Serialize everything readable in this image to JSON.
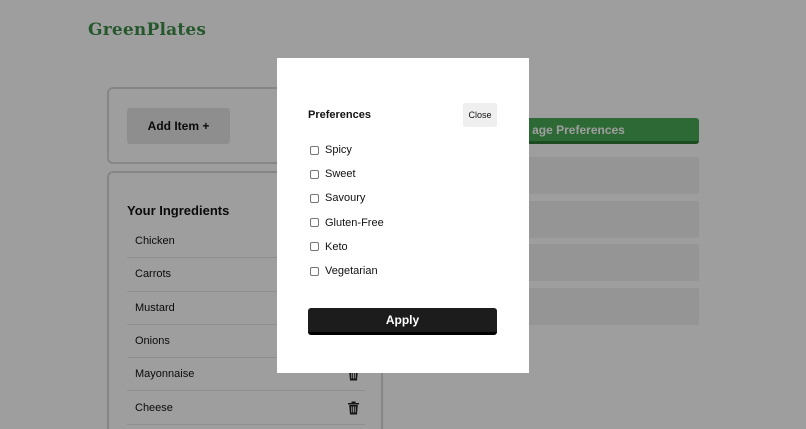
{
  "app": {
    "logo": "GreenPlates"
  },
  "add_panel": {
    "add_button_label": "Add Item +"
  },
  "ingredients": {
    "title": "Your Ingredients",
    "items": [
      {
        "label": "Chicken"
      },
      {
        "label": "Carrots"
      },
      {
        "label": "Mustard"
      },
      {
        "label": "Onions"
      },
      {
        "label": "Mayonnaise"
      },
      {
        "label": "Cheese"
      }
    ],
    "delete_icon": "trash-icon"
  },
  "preferences_panel": {
    "manage_button_label": "age Preferences"
  },
  "modal": {
    "title": "Preferences",
    "close_label": "Close",
    "options": [
      {
        "label": "Spicy",
        "checked": false
      },
      {
        "label": "Sweet",
        "checked": false
      },
      {
        "label": "Savoury",
        "checked": false
      },
      {
        "label": "Gluten-Free",
        "checked": false
      },
      {
        "label": "Keto",
        "checked": false
      },
      {
        "label": "Vegetarian",
        "checked": false
      }
    ],
    "apply_label": "Apply"
  },
  "colors": {
    "brand_green": "#3f8f4a",
    "button_green": "#4aaa56",
    "apply_dark": "#1c1c1c",
    "overlay": "rgba(0,0,0,0.38)"
  }
}
